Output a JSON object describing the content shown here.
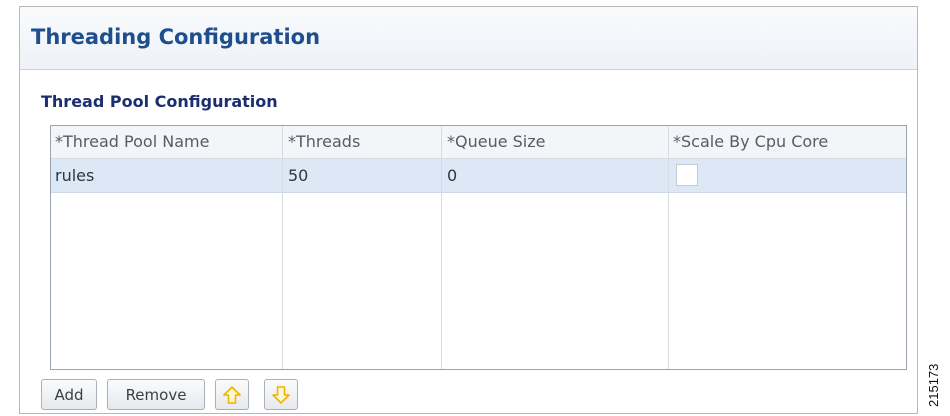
{
  "panel": {
    "title": "Threading Configuration"
  },
  "section": {
    "title": "Thread Pool Configuration"
  },
  "table": {
    "columns": [
      "*Thread Pool Name",
      "*Threads",
      "*Queue Size",
      "*Scale By Cpu Core"
    ],
    "rows": [
      {
        "name": "rules",
        "threads": "50",
        "queue_size": "0",
        "scale_by_cpu_core": false
      }
    ]
  },
  "buttons": {
    "add": "Add",
    "remove": "Remove"
  },
  "icons": {
    "move_up": "arrow-up-icon",
    "move_down": "arrow-down-icon"
  },
  "colors": {
    "title": "#1f4e8c",
    "section_title": "#1b2f6e",
    "selected_row": "#dce8f6",
    "arrow": "#f0b400"
  },
  "figure_id": "215173"
}
